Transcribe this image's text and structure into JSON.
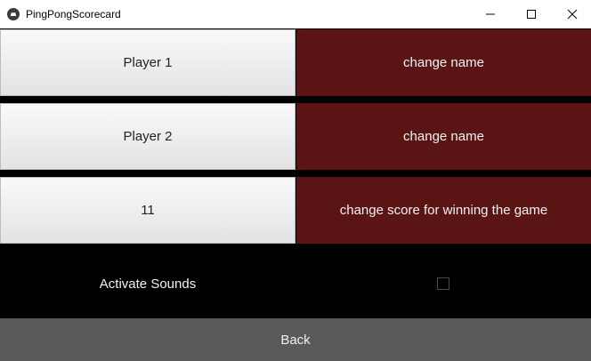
{
  "window": {
    "title": "PingPongScorecard",
    "icon": "kivy-logo-icon",
    "controls": [
      "minimize-icon",
      "maximize-icon",
      "close-icon"
    ]
  },
  "rows": [
    {
      "value": "Player 1",
      "action": "change name"
    },
    {
      "value": "Player 2",
      "action": "change name"
    },
    {
      "value": "11",
      "action": "change score for winning the game"
    }
  ],
  "sounds": {
    "label": "Activate Sounds",
    "checked": false
  },
  "back_label": "Back",
  "colors": {
    "accent": "#5b1414",
    "back_button": "#5a5a5a",
    "background": "#000000"
  }
}
